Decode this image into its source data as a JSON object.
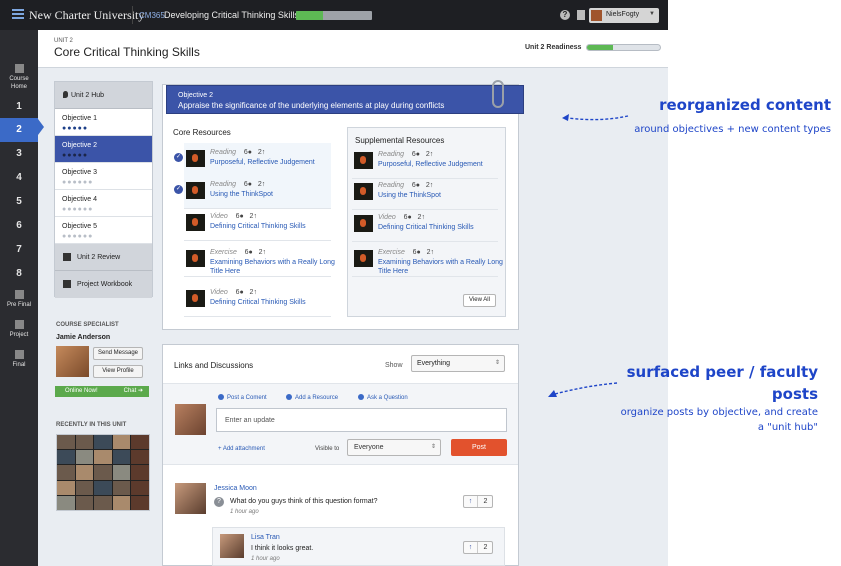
{
  "topbar": {
    "school": "New Charter University",
    "course_code": "CM365",
    "course_name": "Developing Critical Thinking Skills",
    "course_progress_pct": 35,
    "user_name": "NielsFogty",
    "help_label": "?"
  },
  "sidebar": {
    "course_home_line1": "Course",
    "course_home_line2": "Home",
    "units": [
      "1",
      "2",
      "3",
      "4",
      "5",
      "6",
      "7",
      "8"
    ],
    "active_unit": "2",
    "pre_final": "Pre Final",
    "project": "Project",
    "final": "Final"
  },
  "header": {
    "unit_label": "UNIT 2",
    "title": "Core Critical Thinking Skills",
    "readiness_label": "Unit 2 Readiness",
    "readiness_pct": 35
  },
  "objnav": {
    "hub": "Unit 2 Hub",
    "objectives": [
      {
        "label": "Objective 1",
        "dots": "●●●●●"
      },
      {
        "label": "Objective 2",
        "dots": "●●●●●"
      },
      {
        "label": "Objective 3",
        "dots": "●●●●●●"
      },
      {
        "label": "Objective 4",
        "dots": "●●●●●●"
      },
      {
        "label": "Objective 5",
        "dots": "●●●●●●"
      }
    ],
    "review": "Unit 2 Review",
    "workbook": "Project Workbook"
  },
  "specialist": {
    "heading": "COURSE SPECIALIST",
    "name": "Jamie Anderson",
    "send_message": "Send Message",
    "view_profile": "View Profile",
    "online": "Online Now!",
    "chat": "Chat ➔"
  },
  "recent": {
    "heading": "RECENTLY IN THIS UNIT"
  },
  "objective_panel": {
    "kicker": "Objective 2",
    "title": "Appraise the significance of the underlying elements at play during conflicts",
    "core_heading": "Core Resources",
    "supp_heading": "Supplemental Resources",
    "core": [
      {
        "type": "Reading",
        "comments": "6",
        "votes": "2",
        "title": "Purposeful, Reflective Judgement"
      },
      {
        "type": "Reading",
        "comments": "6",
        "votes": "2",
        "title": "Using the ThinkSpot"
      },
      {
        "type": "Video",
        "comments": "6",
        "votes": "2",
        "title": "Defining Critical Thinking Skills"
      },
      {
        "type": "Exercise",
        "comments": "6",
        "votes": "2",
        "title": "Examining Behaviors with a Really Long Title Here"
      },
      {
        "type": "Video",
        "comments": "6",
        "votes": "2",
        "title": "Defining Critical Thinking Skills"
      }
    ],
    "supplemental": [
      {
        "type": "Reading",
        "comments": "6",
        "votes": "2",
        "title": "Purposeful, Reflective Judgement"
      },
      {
        "type": "Reading",
        "comments": "6",
        "votes": "2",
        "title": "Using the ThinkSpot"
      },
      {
        "type": "Video",
        "comments": "6",
        "votes": "2",
        "title": "Defining Critical Thinking Skills"
      },
      {
        "type": "Exercise",
        "comments": "6",
        "votes": "2",
        "title": "Examining Behaviors with a Really Long Title Here"
      }
    ],
    "view_all": "View All"
  },
  "links": {
    "title": "Links and Discussions",
    "show_label": "Show",
    "show_value": "Everything",
    "tabs": [
      "Post a Coment",
      "Add a Resource",
      "Ask a Question"
    ],
    "input_placeholder": "Enter an update",
    "add_attachment": "+ Add attachment",
    "visible_label": "Visible to",
    "visible_value": "Everyone",
    "post_button": "Post"
  },
  "posts": [
    {
      "name": "Jessica Moon",
      "text": "What do you guys think of this question format?",
      "time": "1 hour ago",
      "votes": "2"
    },
    {
      "name": "Lisa Tran",
      "text": "I think it looks great.",
      "time": "1 hour ago",
      "votes": "2"
    }
  ],
  "annotations": [
    {
      "title": "reorganized content",
      "sub": "around objectives + new content types"
    },
    {
      "title_line1": "surfaced peer / faculty",
      "title_line2": "posts",
      "sub_line1": "organize posts by objective, and create",
      "sub_line2": "a \"unit hub\""
    }
  ],
  "colors": {
    "primary": "#3b54a8",
    "accent_link": "#2859b5",
    "post_button": "#e2522d",
    "online": "#5ba94c",
    "annotation": "#1e45c8"
  }
}
